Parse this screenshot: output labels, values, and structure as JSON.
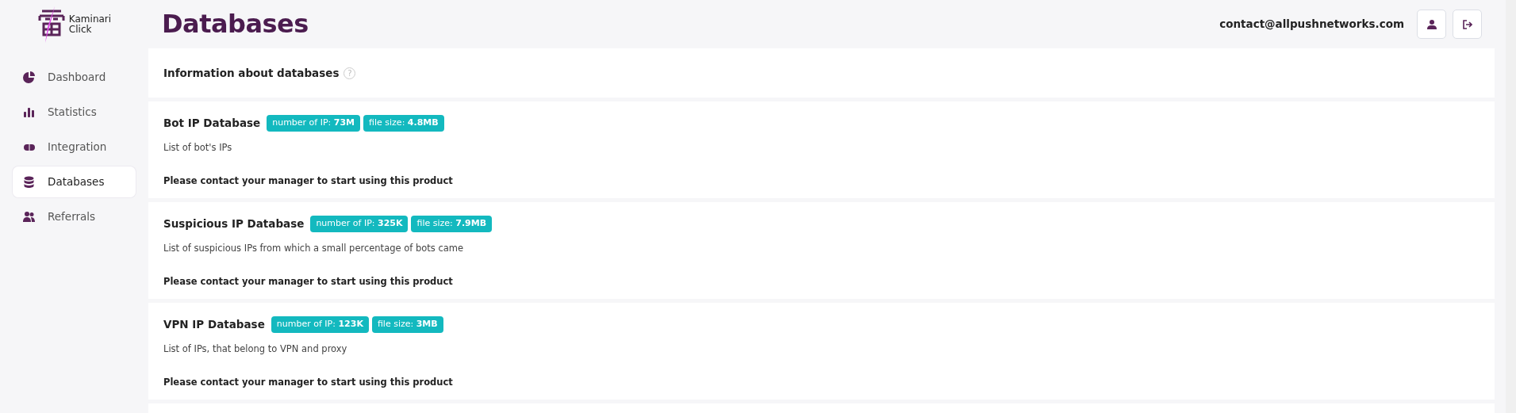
{
  "logo": {
    "line1": "Kaminari",
    "line2": "Click"
  },
  "sidebar": {
    "items": [
      {
        "label": "Dashboard",
        "selected": false
      },
      {
        "label": "Statistics",
        "selected": false
      },
      {
        "label": "Integration",
        "selected": false
      },
      {
        "label": "Databases",
        "selected": true
      },
      {
        "label": "Referrals",
        "selected": false
      }
    ]
  },
  "header": {
    "title": "Databases",
    "email": "contact@allpushnetworks.com"
  },
  "info": {
    "title": "Information about databases",
    "help": "?"
  },
  "databases": [
    {
      "name": "Bot IP Database",
      "badges": [
        "number of IP: **73M**",
        "file size: **4.8MB**"
      ],
      "description": "List of bot's IPs",
      "note": "Please contact your manager to start using this product"
    },
    {
      "name": "Suspicious IP Database",
      "badges": [
        "number of IP: **325K**",
        "file size: **7.9MB**"
      ],
      "description": "List of suspicious IPs from which a small percentage of bots came",
      "note": "Please contact your manager to start using this product"
    },
    {
      "name": "VPN IP Database",
      "badges": [
        "number of IP: **123K**",
        "file size: **3MB**"
      ],
      "description": "List of IPs, that belong to VPN and proxy",
      "note": "Please contact your manager to start using this product"
    }
  ]
}
